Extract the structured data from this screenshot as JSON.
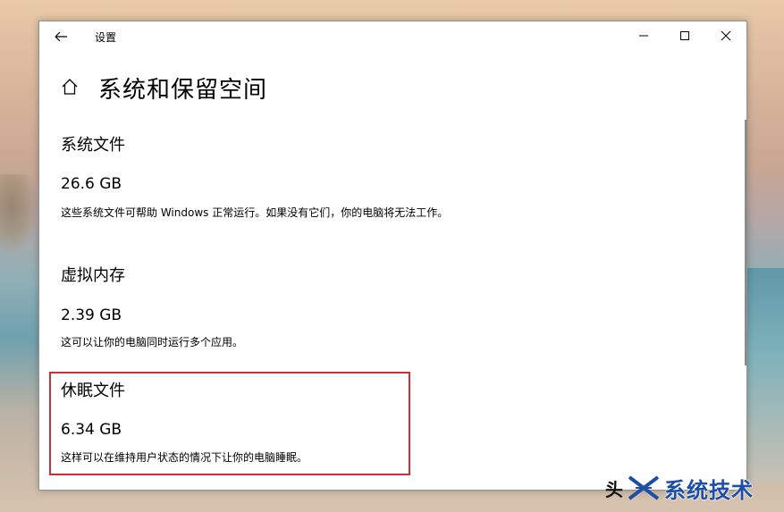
{
  "window": {
    "title": "设置"
  },
  "page": {
    "title": "系统和保留空间"
  },
  "sections": [
    {
      "title": "系统文件",
      "size": "26.6 GB",
      "description": "这些系统文件可帮助 Windows 正常运行。如果没有它们，你的电脑将无法工作。"
    },
    {
      "title": "虚拟内存",
      "size": "2.39 GB",
      "description": "这可以让你的电脑同时运行多个应用。"
    },
    {
      "title": "休眠文件",
      "size": "6.34 GB",
      "description": "这样可以在维持用户状态的情况下让你的电脑睡眠。"
    }
  ],
  "watermark": {
    "prefix": "头",
    "text": "系统技术"
  },
  "colors": {
    "highlight": "#c8313a",
    "watermark": "#1d4fa8"
  },
  "icons": [
    "back-arrow-icon",
    "minimize-icon",
    "maximize-icon",
    "close-icon",
    "home-icon",
    "watermark-logo-icon"
  ]
}
